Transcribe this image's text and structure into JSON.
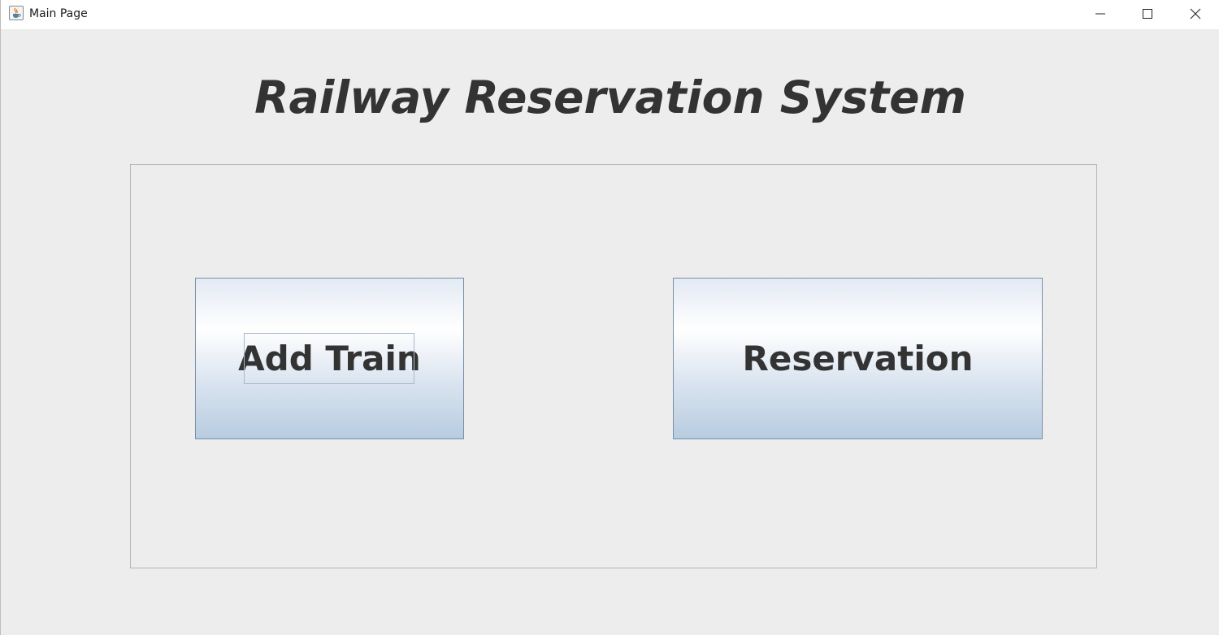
{
  "window": {
    "title": "Main Page",
    "controls": {
      "minimize_icon": "minimize-icon",
      "maximize_icon": "maximize-icon",
      "close_icon": "close-icon"
    }
  },
  "main": {
    "heading": "Railway Reservation System",
    "buttons": {
      "add_train": "Add Train",
      "reservation": "Reservation"
    }
  },
  "colors": {
    "background": "#ededed",
    "text": "#333333",
    "button_border": "#7a8ea8",
    "button_gradient_bottom": "#b8cce0"
  }
}
